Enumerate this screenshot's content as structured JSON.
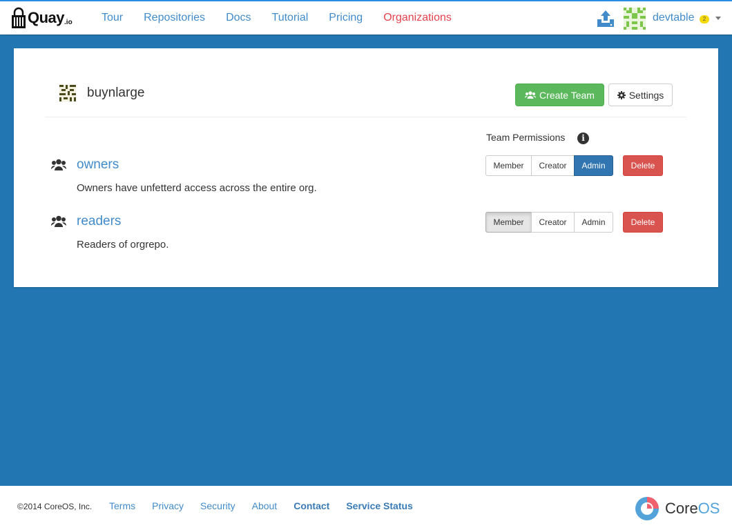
{
  "header": {
    "logo_text": "Quay",
    "logo_suffix": ".io",
    "nav": [
      {
        "label": "Tour",
        "active": false
      },
      {
        "label": "Repositories",
        "active": false
      },
      {
        "label": "Docs",
        "active": false
      },
      {
        "label": "Tutorial",
        "active": false
      },
      {
        "label": "Pricing",
        "active": false
      },
      {
        "label": "Organizations",
        "active": true
      }
    ],
    "username": "devtable",
    "notification_count": "2"
  },
  "org": {
    "name": "buynlarge",
    "create_team_label": "Create Team",
    "settings_label": "Settings",
    "permissions_title": "Team Permissions"
  },
  "teams": [
    {
      "name": "owners",
      "description": "Owners have unfetterd access across the entire org.",
      "roles": [
        "Member",
        "Creator",
        "Admin"
      ],
      "selected_role": "Admin",
      "delete_label": "Delete"
    },
    {
      "name": "readers",
      "description": "Readers of orgrepo.",
      "roles": [
        "Member",
        "Creator",
        "Admin"
      ],
      "selected_role": "Member",
      "delete_label": "Delete"
    }
  ],
  "footer": {
    "copyright": "©2014 CoreOS, Inc.",
    "links": [
      {
        "label": "Terms",
        "strong": false
      },
      {
        "label": "Privacy",
        "strong": false
      },
      {
        "label": "Security",
        "strong": false
      },
      {
        "label": "About",
        "strong": false
      },
      {
        "label": "Contact",
        "strong": true
      },
      {
        "label": "Service Status",
        "strong": true
      }
    ],
    "brand_core": "Core",
    "brand_os": "OS"
  },
  "colors": {
    "page_bg": "#2277b2",
    "link": "#428bca",
    "active_nav": "#e5414e",
    "create_button": "#5cb85c",
    "admin_selected": "#3276b1",
    "delete_button": "#d9534f"
  }
}
